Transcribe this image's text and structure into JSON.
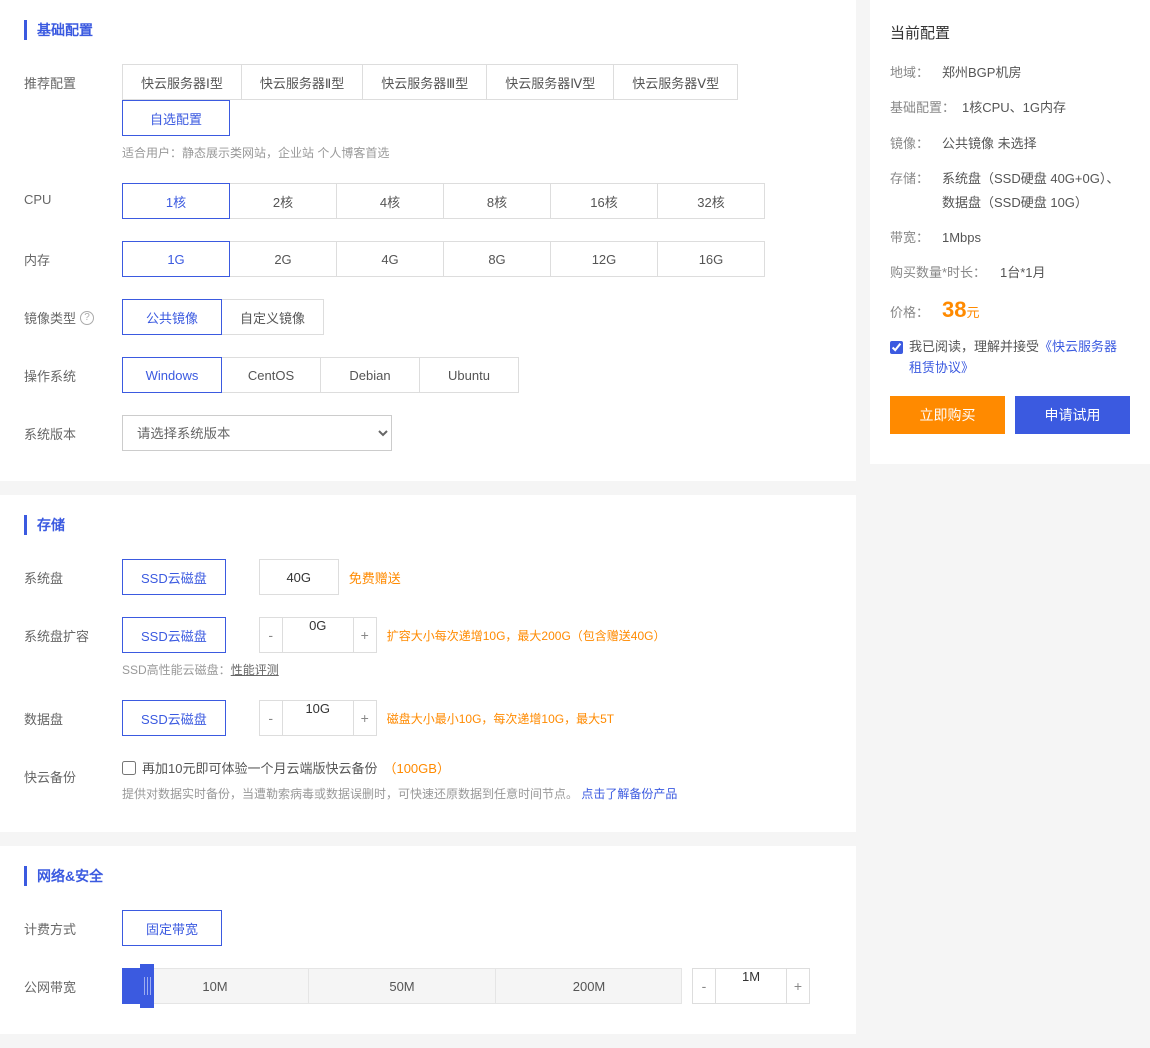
{
  "sections": {
    "basic": "基础配置",
    "storage": "存储",
    "network": "网络&安全"
  },
  "labels": {
    "recommend": "推荐配置",
    "cpu": "CPU",
    "memory": "内存",
    "imageType": "镜像类型",
    "os": "操作系统",
    "sysver": "系统版本",
    "sysDisk": "系统盘",
    "sysDiskExt": "系统盘扩容",
    "dataDisk": "数据盘",
    "backup": "快云备份",
    "billing": "计费方式",
    "bandwidth": "公网带宽"
  },
  "recommend": {
    "options": [
      "快云服务器Ⅰ型",
      "快云服务器Ⅱ型",
      "快云服务器Ⅲ型",
      "快云服务器Ⅳ型",
      "快云服务器Ⅴ型",
      "自选配置"
    ],
    "selectedIndex": 5,
    "hint": "适合用户：静态展示类网站，企业站 个人博客首选"
  },
  "cpu": {
    "options": [
      "1核",
      "2核",
      "4核",
      "8核",
      "16核",
      "32核"
    ],
    "selectedIndex": 0
  },
  "memory": {
    "options": [
      "1G",
      "2G",
      "4G",
      "8G",
      "12G",
      "16G"
    ],
    "selectedIndex": 0
  },
  "imageType": {
    "options": [
      "公共镜像",
      "自定义镜像"
    ],
    "selectedIndex": 0
  },
  "os": {
    "options": [
      "Windows",
      "CentOS",
      "Debian",
      "Ubuntu"
    ],
    "selectedIndex": 0
  },
  "sysver": {
    "placeholder": "请选择系统版本"
  },
  "storage": {
    "ssdLabel": "SSD云磁盘",
    "sysDisk": {
      "size": "40G",
      "gift": "免费赠送"
    },
    "sysDiskExt": {
      "value": "0G",
      "hint": "扩容大小每次递增10G，最大200G（包含赠送40G）"
    },
    "perfLine": "SSD高性能云磁盘：",
    "perfLink": "性能评测",
    "dataDisk": {
      "value": "10G",
      "hint": "磁盘大小最小10G，每次递增10G，最大5T"
    },
    "backup": {
      "checkLabel": "再加10元即可体验一个月云端版快云备份",
      "size": "（100GB）",
      "desc": "提供对数据实时备份，当遭勒索病毒或数据误删时，可快速还原数据到任意时间节点。",
      "link": "点击了解备份产品"
    }
  },
  "network": {
    "billing": {
      "options": [
        "固定带宽"
      ],
      "selectedIndex": 0
    },
    "bandwidth": {
      "marks": [
        "10M",
        "50M",
        "200M"
      ],
      "value": "1M"
    }
  },
  "side": {
    "title": "当前配置",
    "region": {
      "k": "地域：",
      "v": "郑州BGP机房"
    },
    "basic": {
      "k": "基础配置：",
      "v": "1核CPU、1G内存"
    },
    "image": {
      "k": "镜像：",
      "v": "公共镜像 未选择"
    },
    "storageK": "存储：",
    "storageV": "系统盘（SSD硬盘 40G+0G）、 数据盘（SSD硬盘 10G）",
    "bw": {
      "k": "带宽：",
      "v": "1Mbps"
    },
    "qty": {
      "k": "购买数量*时长：",
      "v": "1台*1月"
    },
    "priceK": "价格：",
    "priceNum": "38",
    "priceUnit": "元",
    "agreePrefix": "我已阅读，理解并接受",
    "agreeLink": "《快云服务器租赁协议》",
    "buy": "立即购买",
    "trial": "申请试用"
  }
}
